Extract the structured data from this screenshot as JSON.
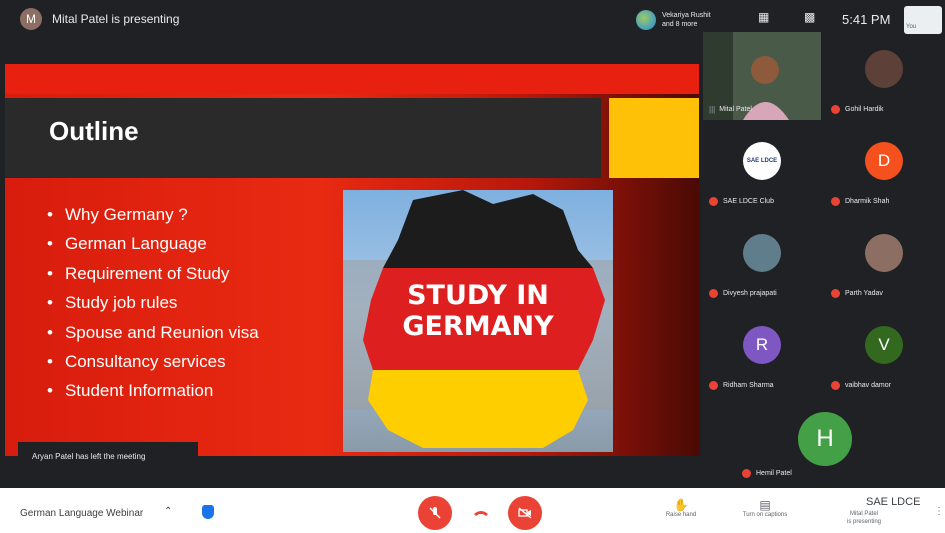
{
  "header": {
    "presenter_initial": "M",
    "presenter_text": "Mital Patel is presenting",
    "joined_text": "Vekariya Rushit\nand 8 more",
    "clock": "5:41 PM",
    "self_label": "You"
  },
  "slide": {
    "title": "Outline",
    "bullets": [
      "Why Germany ?",
      "German Language",
      "Requirement of Study",
      "Study job rules",
      "Spouse and Reunion visa",
      "Consultancy services",
      "Student Information"
    ],
    "image_text_line1": "STUDY IN",
    "image_text_line2": "GERMANY"
  },
  "toast": "Aryan Patel has left the meeting",
  "participants": [
    {
      "name": "Mital Patel",
      "type": "video",
      "mic": "on"
    },
    {
      "name": "Gohil Hardik",
      "type": "photo",
      "color": "#5d4037",
      "initial": ""
    },
    {
      "name": "SAE LDCE Club",
      "type": "logo",
      "color": "#ffffff",
      "initial": "SAE LDCE"
    },
    {
      "name": "Dharmik Shah",
      "type": "avatar",
      "color": "#f4511e",
      "initial": "D"
    },
    {
      "name": "Divyesh prajapati",
      "type": "photo",
      "color": "#607d8b",
      "initial": ""
    },
    {
      "name": "Parth Yadav",
      "type": "photo",
      "color": "#8d6e63",
      "initial": ""
    },
    {
      "name": "Ridham Sharma",
      "type": "avatar",
      "color": "#7e57c2",
      "initial": "R"
    },
    {
      "name": "vaibhav damor",
      "type": "avatar",
      "color": "#33691e",
      "initial": "V"
    }
  ],
  "big_tile": {
    "name": "Hemil Patel",
    "initial": "H",
    "color": "#43a047"
  },
  "footer": {
    "meeting_name": "German Language Webinar",
    "raise_hand": "Raise hand",
    "captions": "Turn on captions",
    "brand": "SAE LDCE",
    "brand_sub": "Mital Patel\nis presenting"
  },
  "colors": {
    "accent_red": "#ea4335",
    "slide_red": "#e8200f",
    "slide_yellow": "#ffc107"
  }
}
